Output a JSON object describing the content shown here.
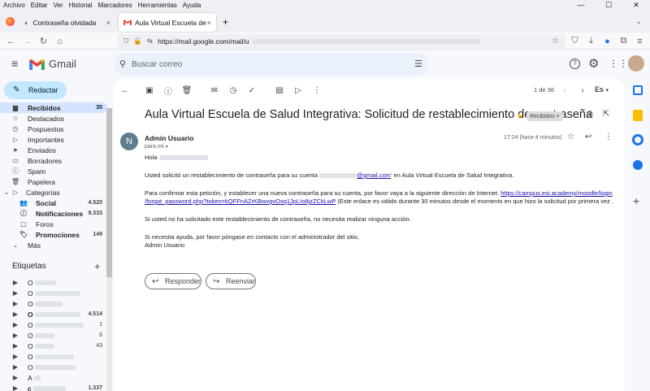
{
  "browser": {
    "menu": [
      "Archivo",
      "Editar",
      "Ver",
      "Historial",
      "Marcadores",
      "Herramientas",
      "Ayuda"
    ],
    "tabs": [
      {
        "title": "Contraseña olvidada",
        "close": "×"
      },
      {
        "title": "Aula Virtual Escuela de Salud In",
        "close": "×"
      }
    ],
    "new_tab": "+",
    "url": "https://mail.google.com/mail/u"
  },
  "gmail": {
    "brand": "Gmail",
    "search_placeholder": "Buscar correo",
    "compose": "Redactar",
    "nav": [
      {
        "label": "Recibidos",
        "count": "35",
        "icon": "inbox-icon"
      },
      {
        "label": "Destacados",
        "count": "",
        "icon": "star-icon"
      },
      {
        "label": "Pospuestos",
        "count": "",
        "icon": "clock-icon"
      },
      {
        "label": "Importantes",
        "count": "",
        "icon": "important-icon"
      },
      {
        "label": "Enviados",
        "count": "",
        "icon": "send-icon"
      },
      {
        "label": "Borradores",
        "count": "",
        "icon": "draft-icon"
      },
      {
        "label": "Spam",
        "count": "",
        "icon": "spam-icon"
      },
      {
        "label": "Papelera",
        "count": "",
        "icon": "trash-icon"
      },
      {
        "label": "Categorías",
        "count": "",
        "icon": "label-icon"
      }
    ],
    "categories": [
      {
        "label": "Social",
        "count": "4.520"
      },
      {
        "label": "Notificaciones",
        "count": "9.333"
      },
      {
        "label": "Foros",
        "count": ""
      },
      {
        "label": "Promociones",
        "count": "149"
      }
    ],
    "more": "Más",
    "labels_title": "Etiquetas",
    "labels": [
      {
        "prefix": "O",
        "count": ""
      },
      {
        "prefix": "O",
        "count": ""
      },
      {
        "prefix": "O",
        "count": ""
      },
      {
        "prefix": "O",
        "count": "4.514"
      },
      {
        "prefix": "O",
        "count": "1"
      },
      {
        "prefix": "O",
        "count": "6"
      },
      {
        "prefix": "O",
        "count": "43"
      },
      {
        "prefix": "O",
        "count": ""
      },
      {
        "prefix": "O",
        "count": ""
      },
      {
        "prefix": "A",
        "count": ""
      },
      {
        "prefix": "c",
        "count": "1.337"
      }
    ],
    "pager": "1 de 36",
    "lang": "Es"
  },
  "email": {
    "subject": "Aula Virtual Escuela de Salud Integrativa: Solicitud de restablecimiento de contraseña",
    "label_chip": "Recibidos ×",
    "sender_initial": "N",
    "sender": "Admin Usuario",
    "to": "para mí",
    "time": "17:24 (hace 4 minutos)",
    "greeting": "Hola",
    "p1a": "Usted solicitó un restablecimiento de contraseña para su cuenta",
    "p1_email": "@gmail.com",
    "p1b": "' en Aula Virtual Escuela de Salud Integrativa.",
    "p2a": "Para confirmar esta petición, y establecer una nueva contraseña para su cuenta, por favor vaya a la siguiente dirección de Internet:",
    "p2_link1": "https://campus.esi.academy/moodle/login",
    "p2_link2": "/forgot_password.php?token=kQFFnAZrKBwvgvOxq1JpLIo8jzZCkLwP",
    "p2b": " (Este enlace es válido durante 30 minutos desde el momento en que hizo la solicitud por primera vez .",
    "p3": "Si usted no ha solicitado este restablecimiento de contraseña, no necesita realizar ninguna acción.",
    "p4": "Si necesita ayuda, por favor póngase en contacto con el administrador del sitio,",
    "p4b": "Admin Usuario",
    "reply": "Responder",
    "forward": "Reenviar"
  }
}
